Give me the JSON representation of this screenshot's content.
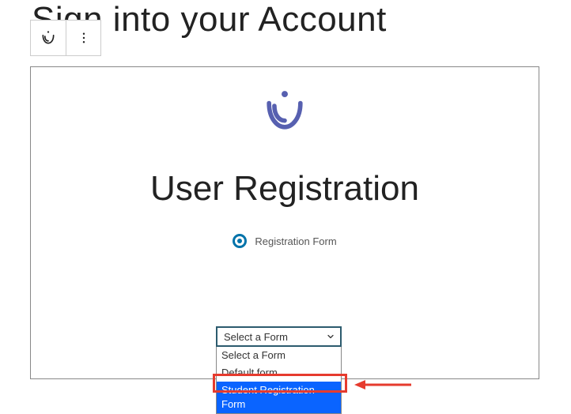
{
  "page": {
    "title": "Sign into your Account"
  },
  "block": {
    "heading": "User Registration",
    "radio_label": "Registration Form"
  },
  "select": {
    "selected": "Select a Form",
    "options": {
      "placeholder": "Select a Form",
      "default": "Default form",
      "student": "Student Registration Form"
    }
  },
  "colors": {
    "brand": "#5760b0",
    "accent": "#0073aa",
    "select_border": "#2c5b6e",
    "highlight_bg": "#0a64ff",
    "annotation": "#e63b2e"
  }
}
